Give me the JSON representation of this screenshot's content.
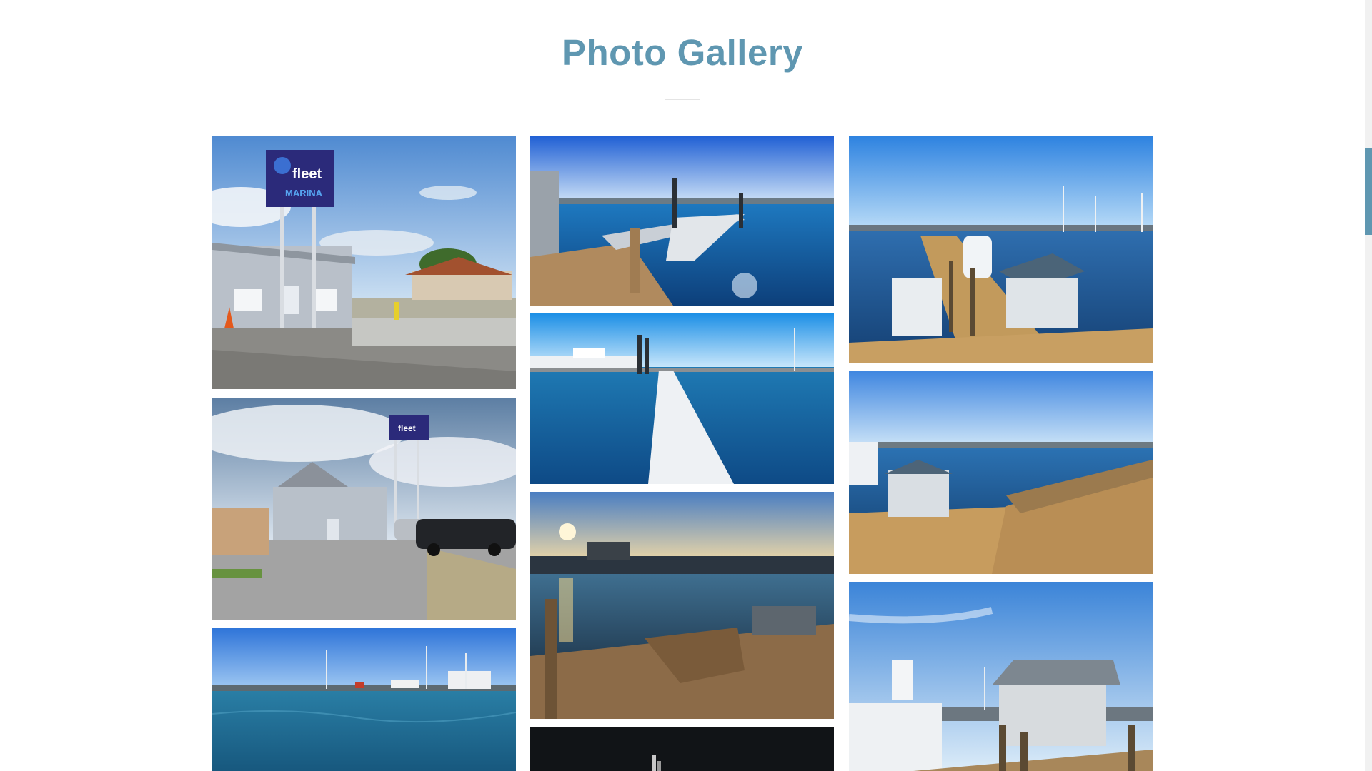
{
  "gallery": {
    "title": "Photo Gallery",
    "photos": [
      {
        "alt": "Fleet Marina sign and office building",
        "sign": "fleet MARINA"
      },
      {
        "alt": "Fleet Marina office with parked cars",
        "sign": "fleet MARINA"
      },
      {
        "alt": "Harbor view with fishing boats"
      },
      {
        "alt": "Gangway leading to floating dock"
      },
      {
        "alt": "White floating dock pointing into the harbor"
      },
      {
        "alt": "Wooden dock at sunset by the bridge"
      },
      {
        "alt": "Harbor at night"
      },
      {
        "alt": "Docks with boats and dock house"
      },
      {
        "alt": "Dock house and deck over the water"
      },
      {
        "alt": "Dock house beside sport fishing boats"
      }
    ]
  },
  "colors": {
    "title": "#5f97b1",
    "divider": "#e4e4e4",
    "scrollbar_thumb": "#5f97b1"
  }
}
